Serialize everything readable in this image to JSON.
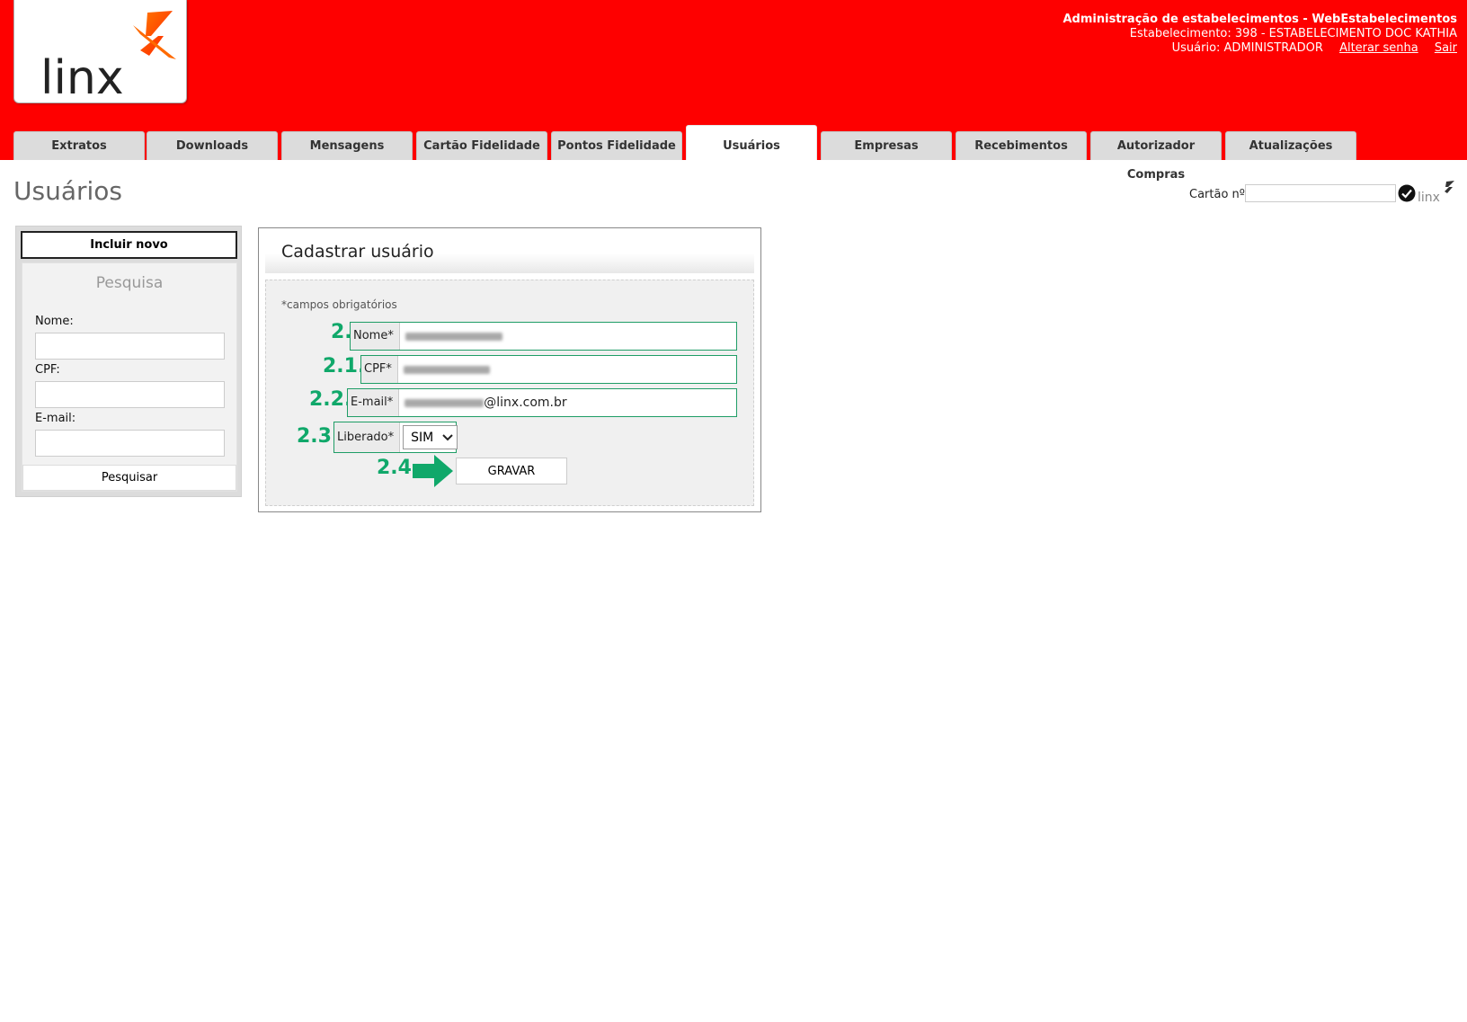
{
  "header": {
    "logo_text": "linx",
    "admin_title": "Administração de estabelecimentos - WebEstabelecimentos",
    "establishment": "Estabelecimento: 398 - ESTABELECIMENTO DOC KATHIA",
    "user": "Usuário: ADMINISTRADOR",
    "change_password": "Alterar senha",
    "logout": "Sair",
    "brand_color": "#fe0000"
  },
  "tabs": [
    {
      "label": "Extratos"
    },
    {
      "label": "Downloads"
    },
    {
      "label": "Mensagens"
    },
    {
      "label": "Cartão Fidelidade"
    },
    {
      "label": "Pontos Fidelidade"
    },
    {
      "label": "Usuários",
      "active": true
    },
    {
      "label": "Empresas"
    },
    {
      "label": "Recebimentos"
    },
    {
      "label": "Autorizador Compras"
    },
    {
      "label": "Atualizações"
    }
  ],
  "page": {
    "title": "Usuários",
    "card_label": "Cartão nº",
    "card_value": ""
  },
  "sidebar": {
    "new_button": "Incluir novo",
    "search_title": "Pesquisa",
    "name_label": "Nome:",
    "cpf_label": "CPF:",
    "email_label": "E-mail:",
    "search_button": "Pesquisar"
  },
  "form": {
    "title": "Cadastrar usuário",
    "required_note": "*campos obrigatórios",
    "fields": {
      "name": {
        "step": "2.",
        "label": "Nome*"
      },
      "cpf": {
        "step": "2.1.",
        "label": "CPF*"
      },
      "email": {
        "step": "2.2.",
        "label": "E-mail*",
        "visible_suffix": "@linx.com.br"
      },
      "released": {
        "step": "2.3.",
        "label": "Liberado*",
        "value": "SIM"
      }
    },
    "save_step": "2.4.",
    "save_button": "GRAVAR",
    "annotation_color": "#10a86a"
  }
}
